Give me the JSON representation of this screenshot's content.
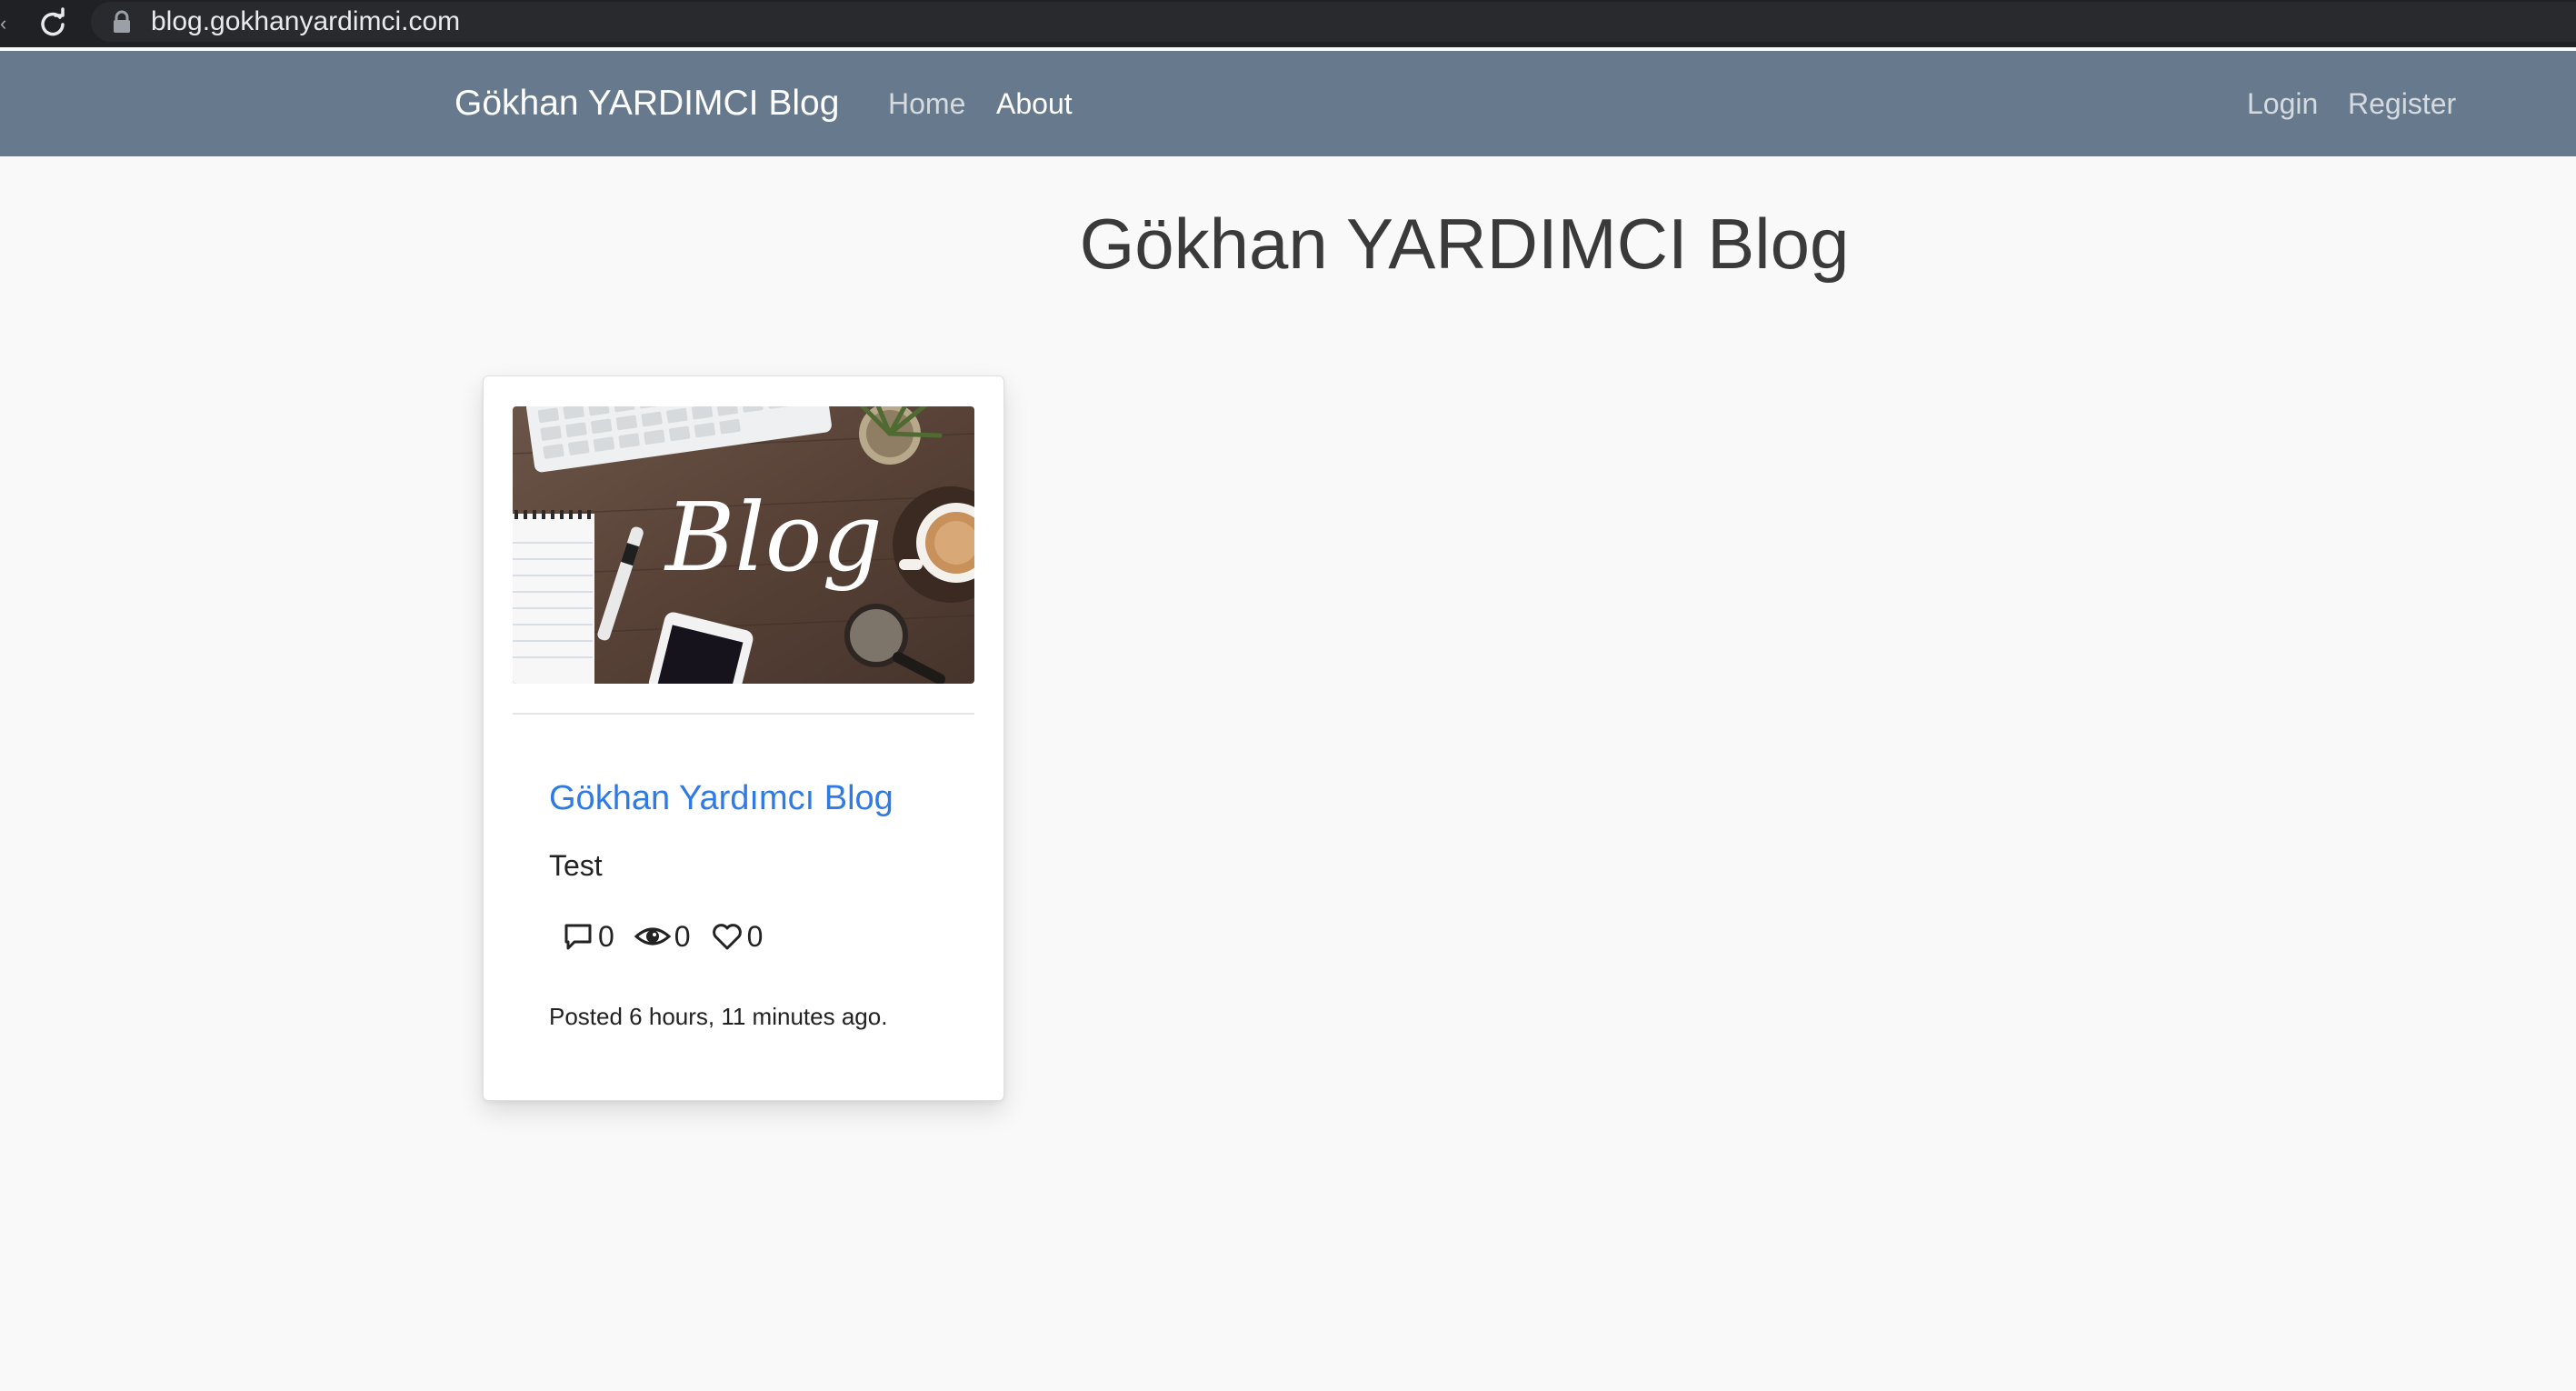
{
  "browser": {
    "url": "blog.gokhanyardimci.com"
  },
  "navbar": {
    "brand": "Gökhan YARDIMCI Blog",
    "links": {
      "home": "Home",
      "about": "About",
      "login": "Login",
      "register": "Register"
    },
    "background_color": "#677a8d"
  },
  "page": {
    "title": "Gökhan YARDIMCI Blog"
  },
  "posts": [
    {
      "image_label": "Blog",
      "title": "Gökhan Yardımcı Blog",
      "excerpt": "Test",
      "comments": "0",
      "views": "0",
      "likes": "0",
      "posted": "Posted 6 hours, 11 minutes ago.",
      "icons": [
        "comment-icon",
        "eye-icon",
        "heart-icon"
      ],
      "title_color": "#2f7ae5"
    }
  ]
}
